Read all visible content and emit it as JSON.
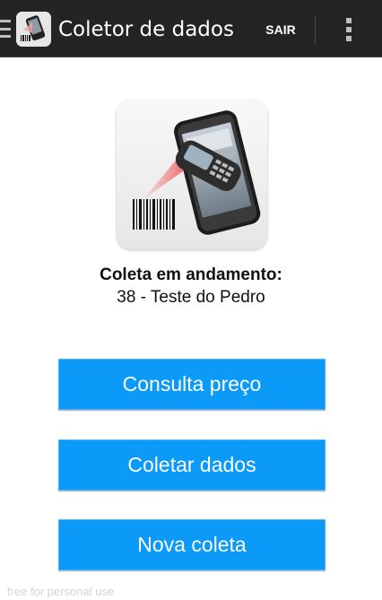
{
  "actionbar": {
    "title": "Coletor de dados",
    "sair_label": "SAIR",
    "icons": [
      "menu-drawer-icon",
      "app-logo-icon",
      "overflow-menu-icon"
    ]
  },
  "status": {
    "label": "Coleta em andamento:",
    "value": "38 - Teste do Pedro"
  },
  "buttons": {
    "consulta": "Consulta preço",
    "coletar": "Coletar dados",
    "nova": "Nova coleta"
  },
  "watermark": "free for personal use",
  "colors": {
    "actionbar": "#242424",
    "button": "#0b9af8",
    "button_text": "#ffffff"
  }
}
